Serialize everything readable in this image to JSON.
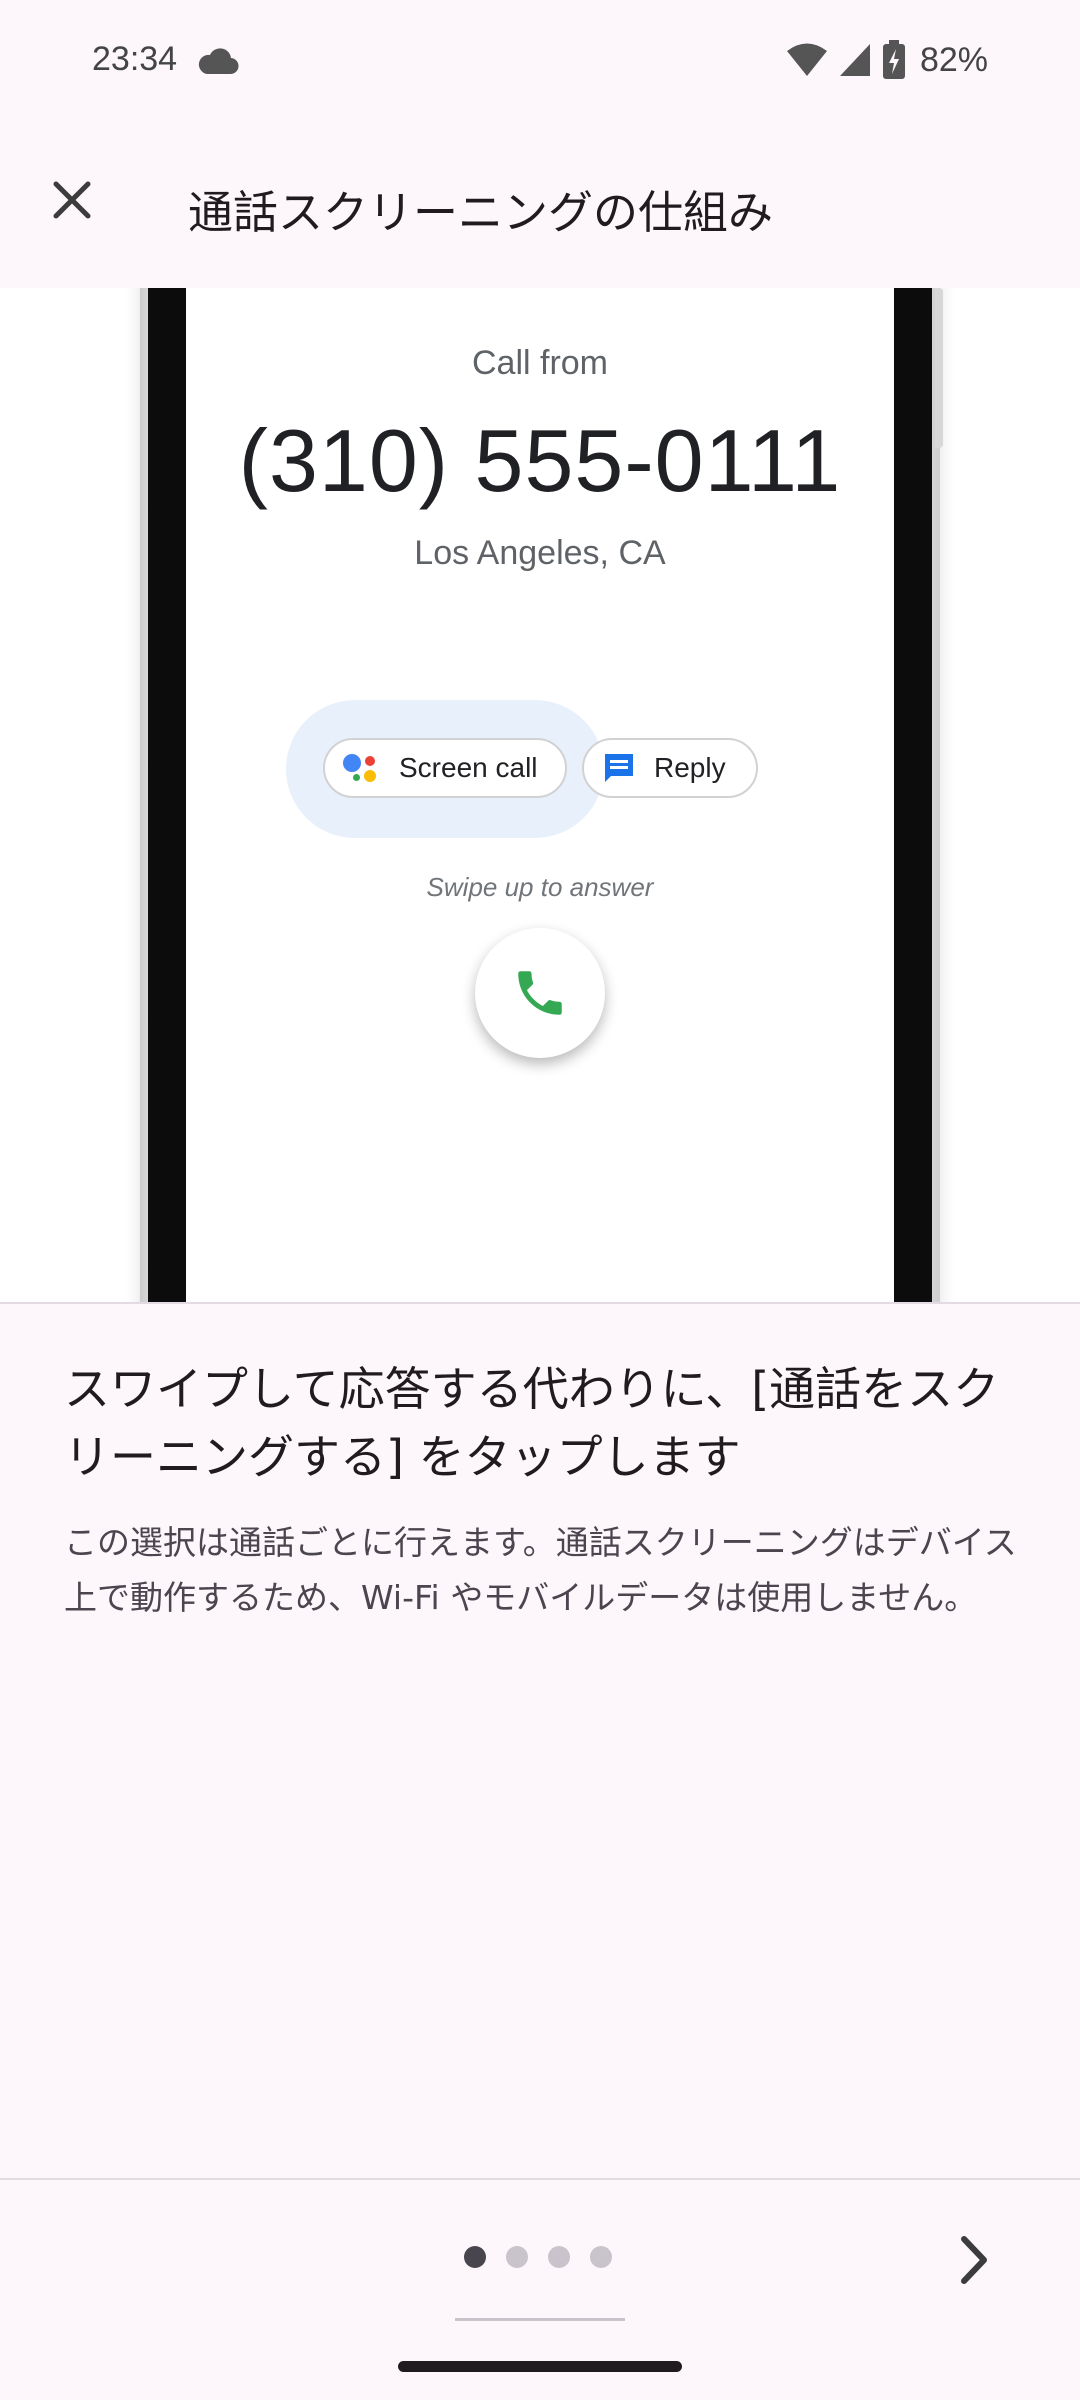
{
  "status_bar": {
    "time": "23:34",
    "battery": "82%"
  },
  "app_bar": {
    "title": "通話スクリーニングの仕組み"
  },
  "illustration": {
    "call_from": "Call from",
    "number": "(310) 555-0111",
    "location": "Los Angeles, CA",
    "screen_call_label": "Screen call",
    "reply_label": "Reply",
    "swipe_hint": "Swipe up to answer"
  },
  "content": {
    "heading": "スワイプして応答する代わりに、[通話をスクリーニングする] をタップします",
    "body": "この選択は通話ごとに行えます。通話スクリーニングはデバイス上で動作するため、Wi-Fi やモバイルデータは使用しません。"
  },
  "pagination": {
    "current_page": 1,
    "total_pages": 4
  },
  "icons": {
    "close": "close-icon",
    "next": "chevron-right-icon",
    "phone": "phone-icon",
    "reply": "message-icon",
    "assistant": "google-assistant-icon",
    "wifi": "wifi-icon",
    "signal": "cellular-signal-icon",
    "battery": "battery-charging-icon",
    "cloud": "cloud-icon"
  },
  "colors": {
    "background": "#fdf7fc",
    "answer_green": "#34a853",
    "reply_blue": "#1a73e8",
    "highlight": "#e8f0fb"
  }
}
